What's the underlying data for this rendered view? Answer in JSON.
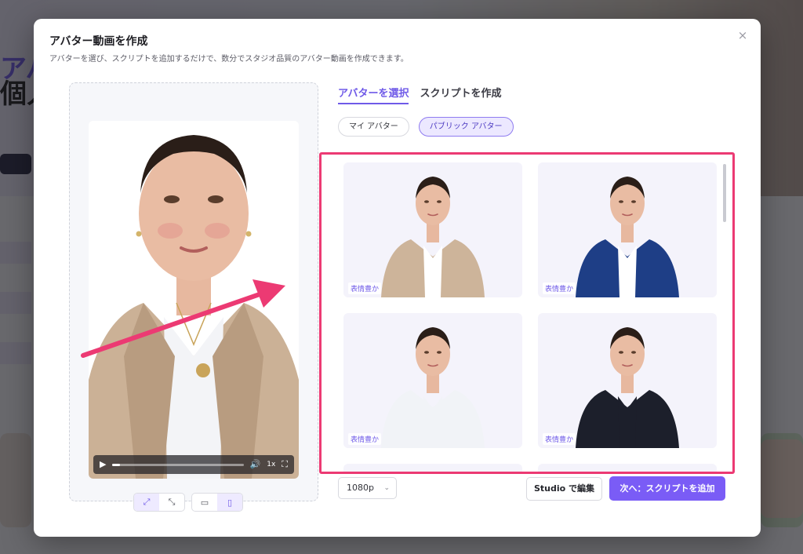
{
  "background": {
    "hero_line1": "アバ",
    "hero_line2": "個人"
  },
  "modal": {
    "title": "アバター動画を作成",
    "subtitle": "アバターを選び、スクリプトを追加するだけで、数分でスタジオ品質のアバター動画を作成できます。",
    "close_icon": "×"
  },
  "preview": {
    "player": {
      "play_icon": "▶",
      "volume_icon": "🔊",
      "speed": "1x",
      "fullscreen_icon": "⛶",
      "progress": 0.06
    },
    "layout_buttons": [
      {
        "icon": "expand-icon",
        "glyph": "⤢",
        "active": true
      },
      {
        "icon": "compress-icon",
        "glyph": "⤡",
        "active": false
      },
      {
        "icon": "landscape-icon",
        "glyph": "▭",
        "active": false
      },
      {
        "icon": "portrait-icon",
        "glyph": "▯",
        "active": true
      }
    ]
  },
  "tabs": [
    {
      "label": "アバターを選択",
      "active": true
    },
    {
      "label": "スクリプトを作成",
      "active": false
    }
  ],
  "filters": [
    {
      "label": "マイ アバター",
      "active": false
    },
    {
      "label": "パブリック アバター",
      "active": true
    }
  ],
  "avatars": [
    {
      "tag": "表情豊か",
      "outfit": "beige-coat",
      "color": "#cdb49a",
      "inner": "#ffffff"
    },
    {
      "tag": "表情豊か",
      "outfit": "navy-blazer",
      "color": "#1e3e86",
      "inner": "#ffffff"
    },
    {
      "tag": "表情豊か",
      "outfit": "white-top",
      "color": "#f1f3f7",
      "inner": "#f1f3f7"
    },
    {
      "tag": "表情豊か",
      "outfit": "black-cardigan",
      "color": "#1c1f2b",
      "inner": "#1c1f2b"
    }
  ],
  "footer": {
    "resolution": "1080p",
    "chevron": "⌄",
    "studio_label": "Studio で編集",
    "next_label": "次へ：スクリプトを追加"
  },
  "colors": {
    "accent": "#7a5cf6",
    "highlight": "#ec3a73"
  }
}
